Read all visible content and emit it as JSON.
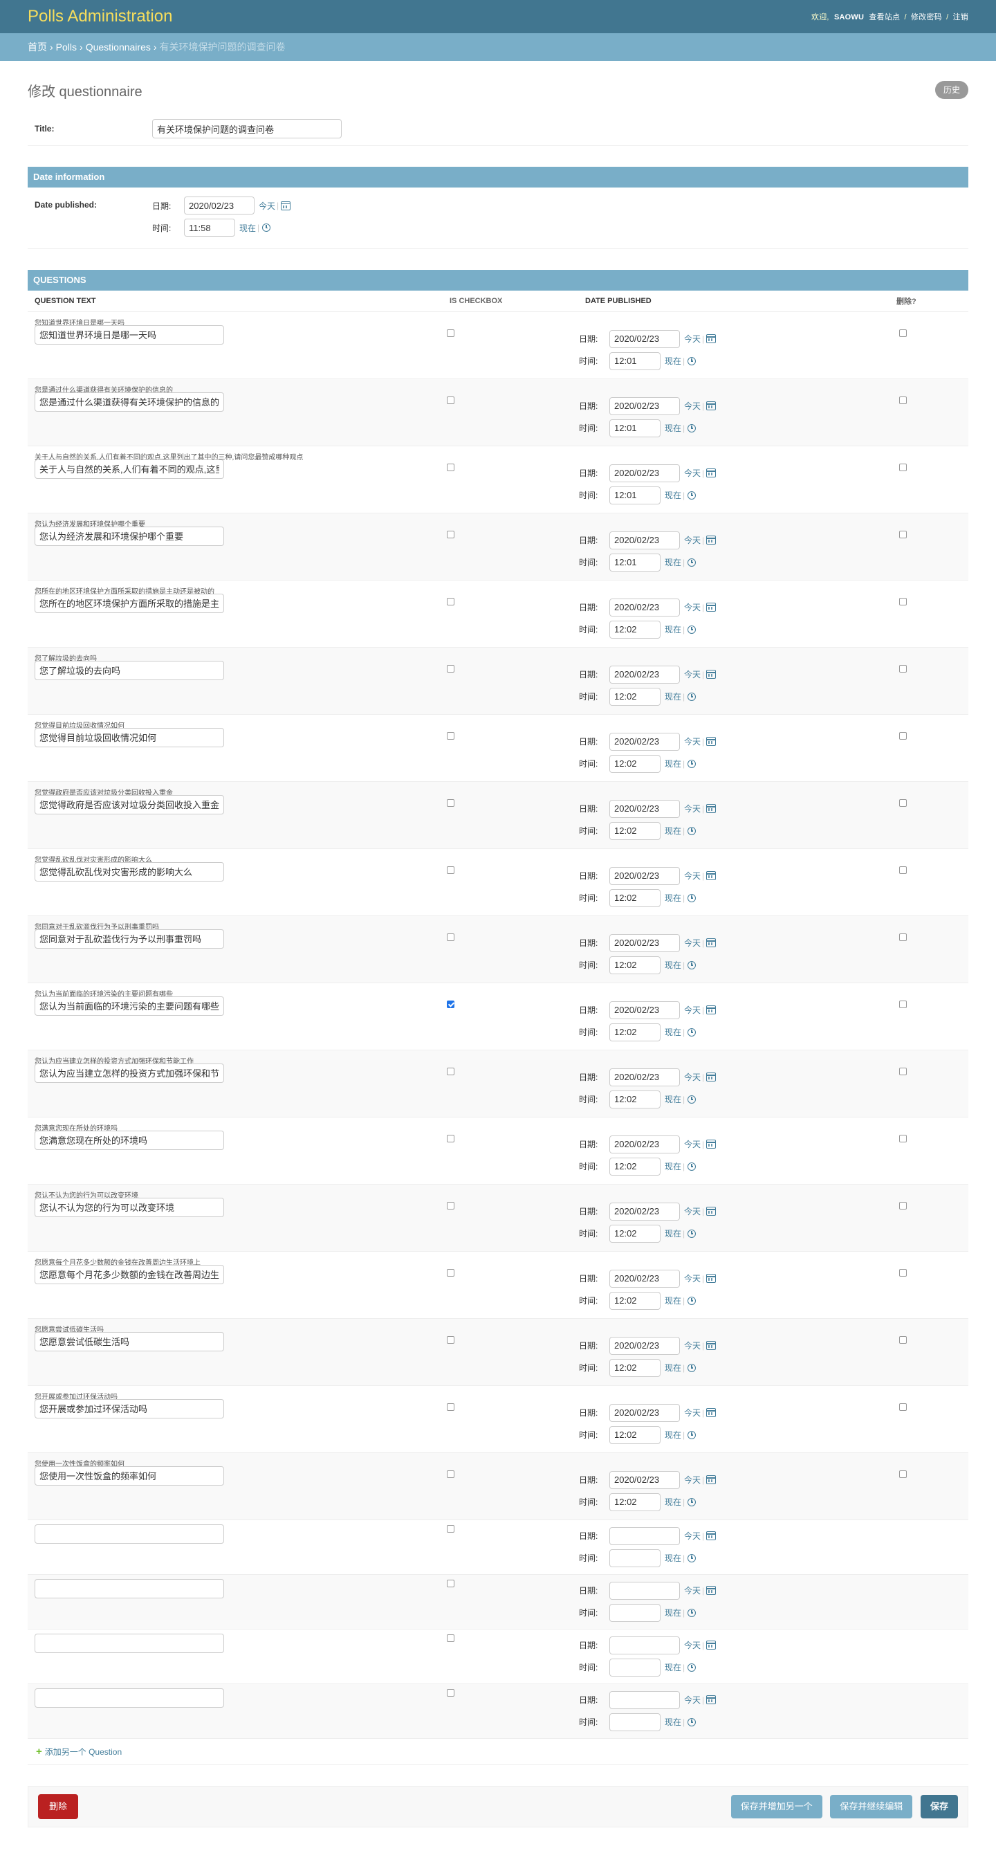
{
  "header": {
    "brand": "Polls Administration",
    "welcome": "欢迎,",
    "username": "SAOWU",
    "view_site": "查看站点",
    "change_password": "修改密码",
    "logout": "注销",
    "separator": "/"
  },
  "breadcrumbs": {
    "home": "首页",
    "app": "Polls",
    "model": "Questionnaires",
    "current": "有关环境保护问题的调查问卷",
    "separator": "›"
  },
  "page": {
    "title": "修改 questionnaire",
    "history": "历史"
  },
  "form": {
    "title_label": "Title:",
    "title_value": "有关环境保护问题的调查问卷"
  },
  "date_info": {
    "heading": "Date information",
    "label": "Date published:",
    "date_label": "日期:",
    "date_value": "2020/02/23",
    "today": "今天",
    "time_label": "时间:",
    "time_value": "11:58",
    "now": "现在",
    "bar": "|"
  },
  "questions": {
    "heading": "QUESTIONS",
    "columns": {
      "text": "QUESTION TEXT",
      "checkbox": "IS CHECKBOX",
      "date": "DATE PUBLISHED",
      "delete": "删除?"
    },
    "date_label": "日期:",
    "time_label": "时间:",
    "today": "今天",
    "now": "现在",
    "add_another": "添加另一个 Question",
    "items": [
      {
        "original": "您知道世界环境日是哪一天吗",
        "value": "您知道世界环境日是哪一天吗",
        "checked": false,
        "date": "2020/02/23",
        "time": "12:01"
      },
      {
        "original": "您是通过什么渠道获得有关环境保护的信息的",
        "value": "您是通过什么渠道获得有关环境保护的信息的",
        "checked": false,
        "date": "2020/02/23",
        "time": "12:01"
      },
      {
        "original": "关于人与自然的关系,人们有着不同的观点,这里列出了其中的三种,请问您最赞成哪种观点",
        "value": "关于人与自然的关系,人们有着不同的观点,这里",
        "checked": false,
        "date": "2020/02/23",
        "time": "12:01"
      },
      {
        "original": "您认为经济发展和环境保护哪个重要",
        "value": "您认为经济发展和环境保护哪个重要",
        "checked": false,
        "date": "2020/02/23",
        "time": "12:01"
      },
      {
        "original": "您所在的地区环境保护方面所采取的措施是主动还是被动的",
        "value": "您所在的地区环境保护方面所采取的措施是主",
        "checked": false,
        "date": "2020/02/23",
        "time": "12:02"
      },
      {
        "original": "您了解垃圾的去向吗",
        "value": "您了解垃圾的去向吗",
        "checked": false,
        "date": "2020/02/23",
        "time": "12:02"
      },
      {
        "original": "您觉得目前垃圾回收情况如何",
        "value": "您觉得目前垃圾回收情况如何",
        "checked": false,
        "date": "2020/02/23",
        "time": "12:02"
      },
      {
        "original": "您觉得政府是否应该对垃圾分类回收投入重金",
        "value": "您觉得政府是否应该对垃圾分类回收投入重金",
        "checked": false,
        "date": "2020/02/23",
        "time": "12:02"
      },
      {
        "original": "您觉得乱砍乱伐对灾害形成的影响大么",
        "value": "您觉得乱砍乱伐对灾害形成的影响大么",
        "checked": false,
        "date": "2020/02/23",
        "time": "12:02"
      },
      {
        "original": "您同意对于乱砍滥伐行为予以刑事重罚吗",
        "value": "您同意对于乱砍滥伐行为予以刑事重罚吗",
        "checked": false,
        "date": "2020/02/23",
        "time": "12:02"
      },
      {
        "original": "您认为当前面临的环境污染的主要问题有哪些",
        "value": "您认为当前面临的环境污染的主要问题有哪些",
        "checked": true,
        "date": "2020/02/23",
        "time": "12:02"
      },
      {
        "original": "您认为应当建立怎样的投资方式加强环保和节能工作",
        "value": "您认为应当建立怎样的投资方式加强环保和节",
        "checked": false,
        "date": "2020/02/23",
        "time": "12:02"
      },
      {
        "original": "您满意您现在所处的环境吗",
        "value": "您满意您现在所处的环境吗",
        "checked": false,
        "date": "2020/02/23",
        "time": "12:02"
      },
      {
        "original": "您认不认为您的行为可以改变环境",
        "value": "您认不认为您的行为可以改变环境",
        "checked": false,
        "date": "2020/02/23",
        "time": "12:02"
      },
      {
        "original": "您愿意每个月花多少数额的金钱在改善周边生活环境上",
        "value": "您愿意每个月花多少数额的金钱在改善周边生",
        "checked": false,
        "date": "2020/02/23",
        "time": "12:02"
      },
      {
        "original": "您愿意尝试低碳生活吗",
        "value": "您愿意尝试低碳生活吗",
        "checked": false,
        "date": "2020/02/23",
        "time": "12:02"
      },
      {
        "original": "您开展或参加过环保活动吗",
        "value": "您开展或参加过环保活动吗",
        "checked": false,
        "date": "2020/02/23",
        "time": "12:02"
      },
      {
        "original": "您使用一次性饭盒的频率如何",
        "value": "您使用一次性饭盒的频率如何",
        "checked": false,
        "date": "2020/02/23",
        "time": "12:02"
      }
    ],
    "empty_forms": 4
  },
  "submit": {
    "delete": "删除",
    "save_add": "保存并增加另一个",
    "save_continue": "保存并继续编辑",
    "save": "保存"
  },
  "colors": {
    "header_bg": "#417690",
    "breadcrumb_bg": "#79aec8",
    "brand": "#f5dd5d",
    "link": "#447e9b",
    "delete": "#ba2121"
  }
}
